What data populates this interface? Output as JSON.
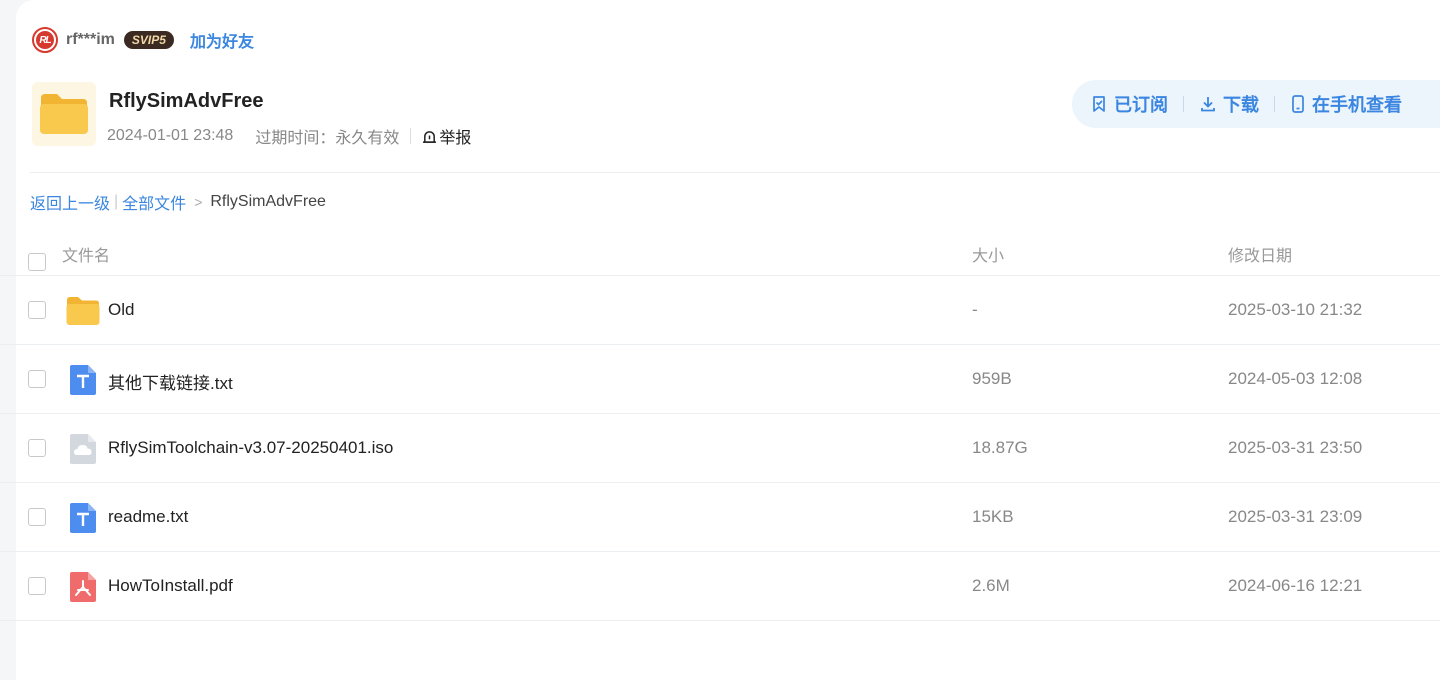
{
  "user": {
    "avatar_text": "RL",
    "name": "rf***im",
    "vip": "SVIP5",
    "add_friend": "加为好友"
  },
  "folder": {
    "title": "RflySimAdvFree",
    "date": "2024-01-01 23:48",
    "expiry": "过期时间：永久有效",
    "report": "举报"
  },
  "actions": {
    "subscribed": "已订阅",
    "download": "下载",
    "mobile": "在手机查看"
  },
  "breadcrumb": {
    "back": "返回上一级",
    "all": "全部文件",
    "current": "RflySimAdvFree"
  },
  "table": {
    "headers": {
      "name": "文件名",
      "size": "大小",
      "date": "修改日期"
    },
    "rows": [
      {
        "icon": "folder-icon",
        "name": "Old",
        "size": "-",
        "date": "2025-03-10 21:32"
      },
      {
        "icon": "txt-file-icon",
        "name": "其他下载链接.txt",
        "size": "959B",
        "date": "2024-05-03 12:08"
      },
      {
        "icon": "iso-file-icon",
        "name": "RflySimToolchain-v3.07-20250401.iso",
        "size": "18.87G",
        "date": "2025-03-31 23:50"
      },
      {
        "icon": "txt-file-icon",
        "name": "readme.txt",
        "size": "15KB",
        "date": "2025-03-31 23:09"
      },
      {
        "icon": "pdf-file-icon",
        "name": "HowToInstall.pdf",
        "size": "2.6M",
        "date": "2024-06-16 12:21"
      }
    ]
  },
  "colors": {
    "accent": "#3b86e0",
    "folder": "#f9c94e",
    "txt": "#4d8df0",
    "pdf": "#f06b6b",
    "iso": "#d3d8de"
  }
}
